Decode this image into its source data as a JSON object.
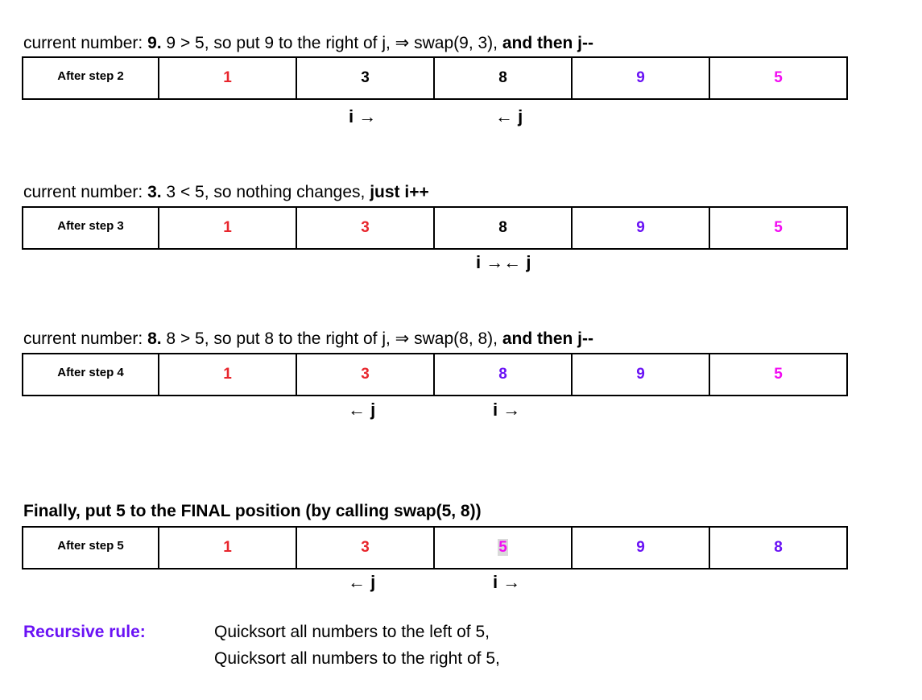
{
  "steps": [
    {
      "caption_parts": [
        "current number: ",
        "9.",
        "  9 > 5, so put 9 to the right of j, ⇒  swap(9, 3), ",
        "and then j--"
      ],
      "label": "After step 2",
      "cells": [
        "1",
        "3",
        "8",
        "9",
        "5"
      ],
      "pointers": [
        {
          "text": "i →"
        },
        {
          "text": "← j"
        }
      ]
    },
    {
      "caption_parts": [
        "current number: ",
        "3.",
        "  3 < 5, so nothing changes, ",
        "just i++"
      ],
      "label": "After step 3",
      "cells": [
        "1",
        "3",
        "8",
        "9",
        "5"
      ],
      "pointers": [
        {
          "text": "i →← j"
        }
      ]
    },
    {
      "caption_parts": [
        "current number: ",
        "8.",
        "  8 > 5, so put 8 to the right of j, ⇒  swap(8, 8), ",
        "and then j--"
      ],
      "label": "After step 4",
      "cells": [
        "1",
        "3",
        "8",
        "9",
        "5"
      ],
      "pointers": [
        {
          "text": "← j"
        },
        {
          "text": "i →"
        }
      ]
    },
    {
      "caption_parts": [
        "Finally, put 5 to the FINAL position   (by calling swap(5, 8))"
      ],
      "label": "After step 5",
      "cells": [
        "1",
        "3",
        "5",
        "9",
        "8"
      ],
      "pointers": [
        {
          "text": "← j"
        },
        {
          "text": "i →"
        }
      ]
    }
  ],
  "colors": {
    "red": "#e8262d",
    "purple": "#6a12f5",
    "magenta": "#f20bf2",
    "highlight": "#d9d9d9"
  },
  "recursive": {
    "label": "Recursive rule:",
    "lines": [
      "Quicksort all numbers to the left of 5,",
      "Quicksort all numbers to the right of 5,"
    ]
  }
}
